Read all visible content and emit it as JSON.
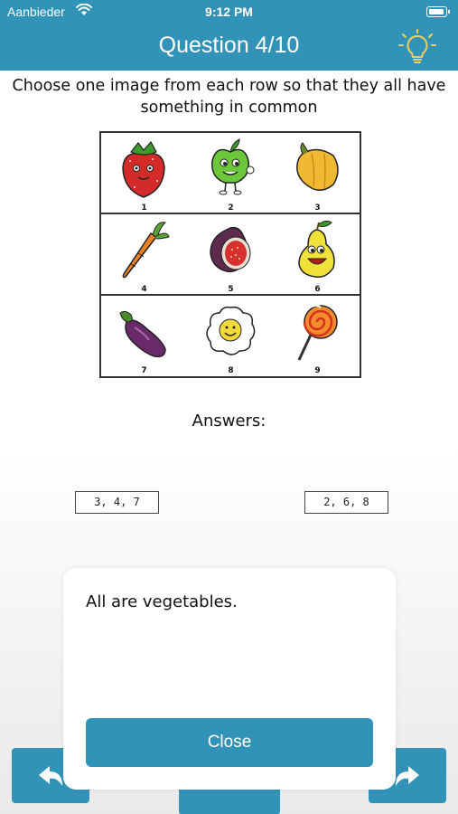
{
  "status_bar": {
    "carrier": "Aanbieder",
    "time": "9:12 PM"
  },
  "header": {
    "title": "Question 4/10",
    "hint_icon": "lightbulb-icon"
  },
  "question": {
    "prompt": "Choose one image from each row so that they all have something in common"
  },
  "grid": {
    "rows": [
      [
        {
          "number": "1",
          "icon": "strawberry-icon"
        },
        {
          "number": "2",
          "icon": "apple-icon"
        },
        {
          "number": "3",
          "icon": "bell-pepper-icon"
        }
      ],
      [
        {
          "number": "4",
          "icon": "carrot-icon"
        },
        {
          "number": "5",
          "icon": "fig-icon"
        },
        {
          "number": "6",
          "icon": "pear-icon"
        }
      ],
      [
        {
          "number": "7",
          "icon": "eggplant-icon"
        },
        {
          "number": "8",
          "icon": "fried-egg-icon"
        },
        {
          "number": "9",
          "icon": "lollipop-icon"
        }
      ]
    ]
  },
  "answers": {
    "label": "Answers:",
    "options": [
      "3, 4, 7",
      "2, 6, 8"
    ]
  },
  "modal": {
    "message": "All are vegetables.",
    "close_label": "Close"
  },
  "nav": {
    "back_icon": "undo-arrow-icon",
    "forward_icon": "redo-arrow-icon"
  },
  "colors": {
    "accent": "#3293b9"
  }
}
